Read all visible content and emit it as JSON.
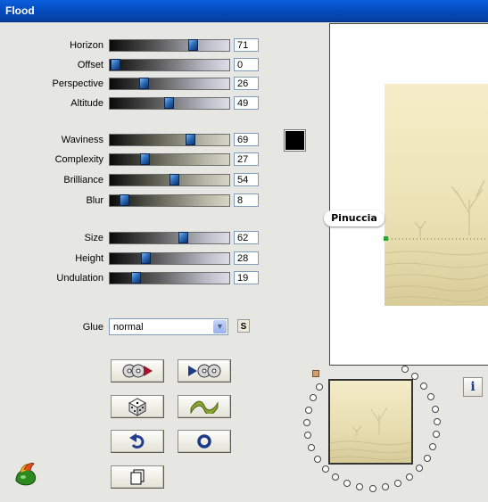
{
  "window": {
    "title": "Flood"
  },
  "sliders": [
    {
      "label": "Horizon",
      "value": "71",
      "fraction": 0.71
    },
    {
      "label": "Offset",
      "value": "0",
      "fraction": 0.0
    },
    {
      "label": "Perspective",
      "value": "26",
      "fraction": 0.26
    },
    {
      "label": "Altitude",
      "value": "49",
      "fraction": 0.49
    },
    {
      "label": "Waviness",
      "value": "69",
      "fraction": 0.69
    },
    {
      "label": "Complexity",
      "value": "27",
      "fraction": 0.27
    },
    {
      "label": "Brilliance",
      "value": "54",
      "fraction": 0.54
    },
    {
      "label": "Blur",
      "value": "8",
      "fraction": 0.08
    },
    {
      "label": "Size",
      "value": "62",
      "fraction": 0.62
    },
    {
      "label": "Height",
      "value": "28",
      "fraction": 0.28
    },
    {
      "label": "Undulation",
      "value": "19",
      "fraction": 0.19
    }
  ],
  "color_swatch": {
    "color": "#000000"
  },
  "glue": {
    "label": "Glue",
    "value": "normal",
    "s_label": "S"
  },
  "buttons": {
    "load_preset_icon": "load-preset-icon",
    "save_preset_icon": "save-preset-icon",
    "random_icon": "dice-icon",
    "wave_icon": "wave-icon",
    "undo_icon": "undo-icon",
    "reset_icon": "reset-icon",
    "copy_icon": "copy-icon"
  },
  "preview": {
    "watermark": "Pinuccia"
  },
  "info": {
    "label": "i"
  },
  "colors": {
    "accent": "#0548b9",
    "thumb": "#2d6fbd",
    "handle": "#d39d6c"
  }
}
